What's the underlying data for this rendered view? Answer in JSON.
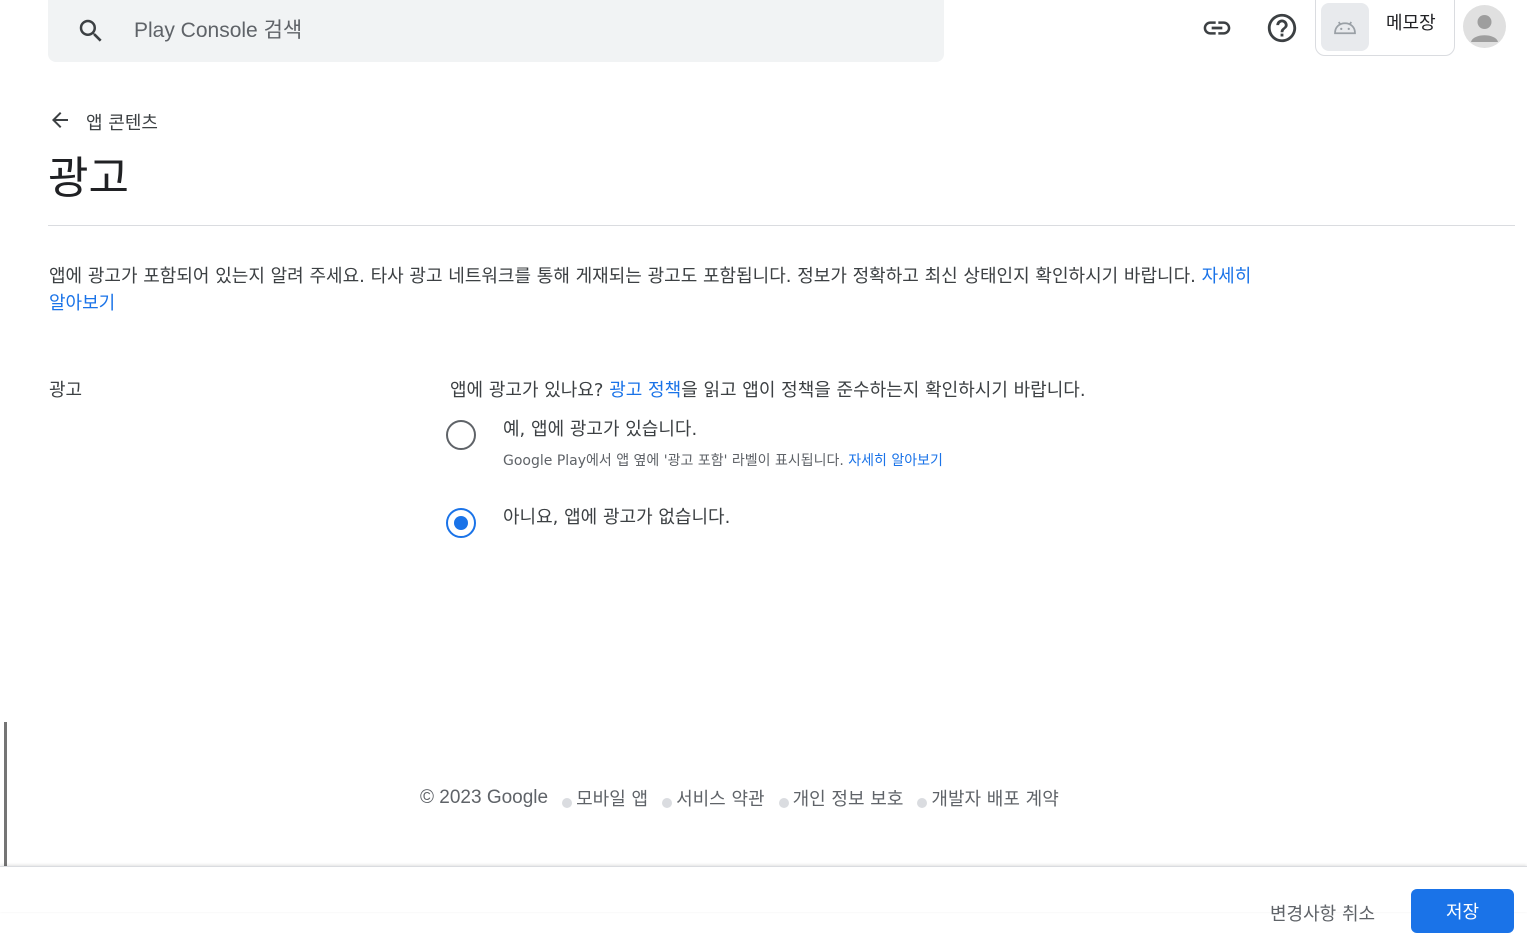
{
  "search": {
    "placeholder": "Play Console 검색"
  },
  "header": {
    "app_name": "메모장",
    "icons": [
      "search-icon",
      "link-icon",
      "help-icon",
      "android-icon",
      "avatar-icon"
    ]
  },
  "page": {
    "back_label": "앱 콘텐츠",
    "title": "광고",
    "intro_text": "앱에 광고가 포함되어 있는지 알려 주세요. 타사 광고 네트워크를 통해 게재되는 광고도 포함됩니다. 정보가 정확하고 최신 상태인지 확인하시기 바랍니다.",
    "intro_link": "자세히 알아보기"
  },
  "ads_section": {
    "label": "광고",
    "question_prefix": "앱에 광고가 있나요?",
    "question_link": "광고 정책",
    "question_suffix": "을 읽고 앱이 정책을 준수하는지 확인하시기 바랍니다.",
    "options": [
      {
        "label": "예, 앱에 광고가 있습니다.",
        "sub": "Google Play에서 앱 옆에 '광고 포함' 라벨이 표시됩니다.",
        "sub_link": "자세히 알아보기",
        "selected": false
      },
      {
        "label": "아니요, 앱에 광고가 없습니다.",
        "selected": true
      }
    ]
  },
  "footer": {
    "copyright": "© 2023 Google",
    "links": [
      "모바일 앱",
      "서비스 약관",
      "개인 정보 보호",
      "개발자 배포 계약"
    ]
  },
  "actions": {
    "discard_label": "변경사항 취소",
    "save_label": "저장"
  },
  "colors": {
    "accent": "#1a73e8",
    "text": "#202124",
    "secondary_text": "#5f6368",
    "divider": "#dadce0"
  }
}
